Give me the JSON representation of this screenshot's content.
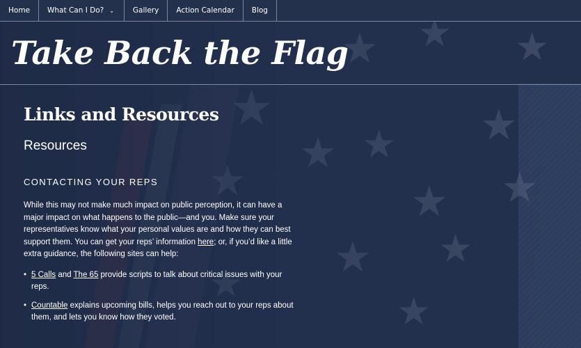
{
  "nav": {
    "items": [
      {
        "label": "Home"
      },
      {
        "label": "What Can I Do?"
      },
      {
        "label": "Gallery"
      },
      {
        "label": "Action Calendar"
      },
      {
        "label": "Blog"
      }
    ]
  },
  "header": {
    "site_title": "Take Back the Flag"
  },
  "main": {
    "page_title": "Links and Resources",
    "section_title": "Resources",
    "subsection_title": "CONTACTING YOUR REPS",
    "paragraph": {
      "text1": "While this may not make much impact on public perception, it can have a major impact on what happens to the public—and you. Make sure your representatives know what your personal values are and how they can best support them. You can get your reps’ information ",
      "link_here": "here",
      "text2": "; or, if you’d like a little extra guidance, the following sites can help:"
    },
    "list": [
      {
        "link1": "5 Calls",
        "mid": " and ",
        "link2": "The 65",
        "rest": " provide scripts to talk about critical issues with your reps."
      },
      {
        "link1": "Countable",
        "rest": " explains upcoming bills, helps you reach out to your reps about them, and lets you know how they voted."
      }
    ]
  }
}
